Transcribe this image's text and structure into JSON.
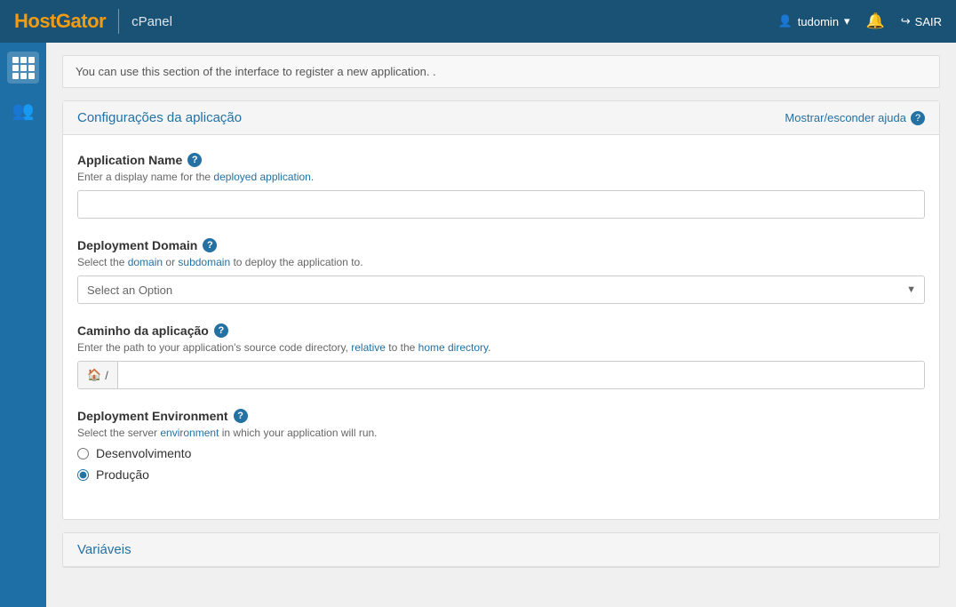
{
  "header": {
    "logo_host": "Host",
    "logo_gator": "Gator",
    "cpanel_label": "cPanel",
    "user": {
      "name": "tudomin",
      "dropdown_icon": "▾"
    },
    "bell_icon": "🔔",
    "exit_label": "SAIR",
    "exit_icon": "⎋"
  },
  "sidebar": {
    "icons": [
      {
        "name": "grid-icon",
        "glyph": "grid",
        "active": true
      },
      {
        "name": "users-icon",
        "glyph": "👥",
        "active": false
      }
    ]
  },
  "info_bar": {
    "text": "You can use this section of the interface to register a new application. ."
  },
  "config_card": {
    "title": "Configurações da aplicação",
    "help_link": "Mostrar/esconder ajuda",
    "help_icon": "?",
    "fields": {
      "app_name": {
        "label": "Application Name",
        "help_icon": "?",
        "hint": "Enter a display name for the deployed application.",
        "hint_link": "deployed application",
        "placeholder": ""
      },
      "deployment_domain": {
        "label": "Deployment Domain",
        "help_icon": "?",
        "hint": "Select the domain or subdomain to deploy the application to.",
        "hint_link1": "domain",
        "hint_link2": "subdomain",
        "select_placeholder": "Select an Option"
      },
      "app_path": {
        "label": "Caminho da aplicação",
        "help_icon": "?",
        "hint_pre": "Enter the path to your application's source code directory,",
        "hint_link": "relative",
        "hint_post": "to the home directory.",
        "prefix": "🏠 /",
        "placeholder": ""
      },
      "deployment_env": {
        "label": "Deployment Environment",
        "help_icon": "?",
        "hint_pre": "Select the server",
        "hint_link": "environment",
        "hint_post": "in which your application will run.",
        "options": [
          {
            "value": "development",
            "label": "Desenvolvimento",
            "checked": false
          },
          {
            "value": "production",
            "label": "Produção",
            "checked": true
          }
        ]
      }
    }
  },
  "variables_card": {
    "title": "Variáveis"
  }
}
